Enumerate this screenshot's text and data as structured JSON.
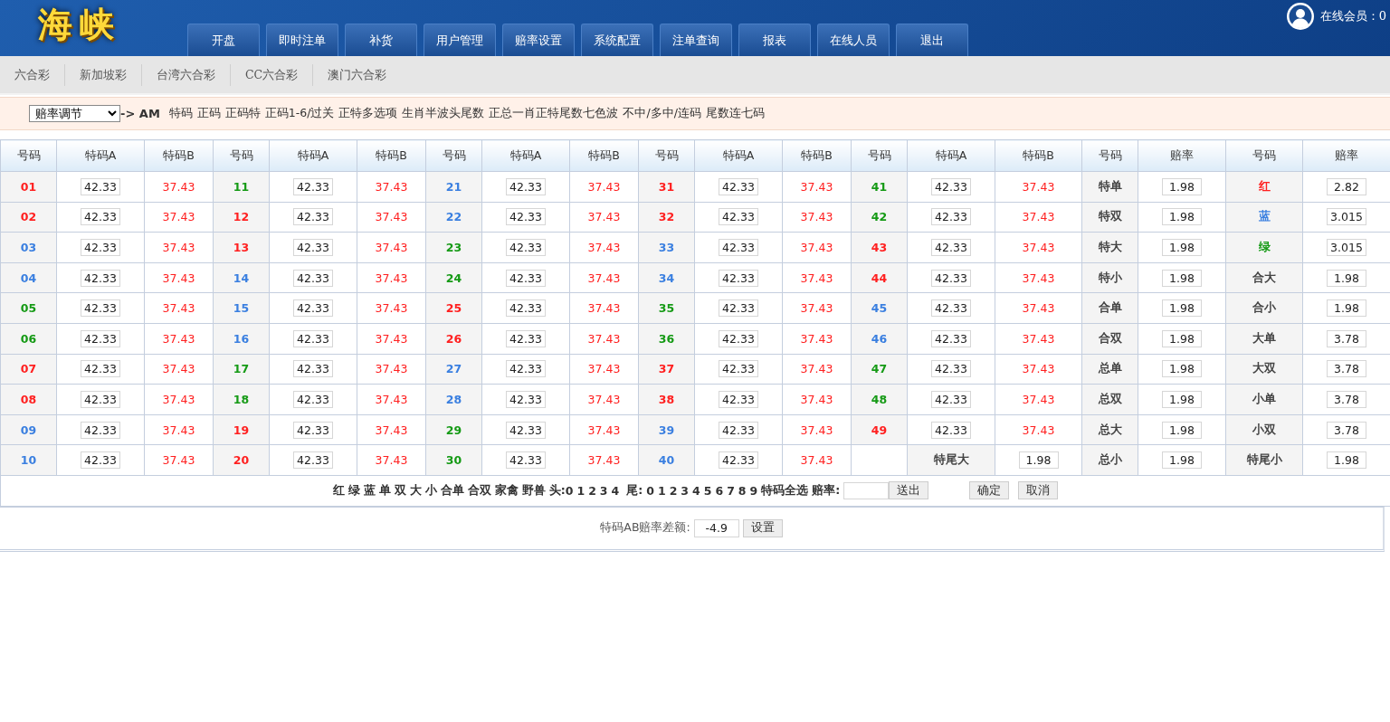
{
  "header": {
    "logo": "海峡",
    "nav": [
      "开盘",
      "即时注单",
      "补货",
      "用户管理",
      "赔率设置",
      "系统配置",
      "注单查询",
      "报表",
      "在线人员",
      "退出"
    ],
    "online": "在线会员：0"
  },
  "subnav": [
    "六合彩",
    "新加坡彩",
    "台湾六合彩",
    "CC六合彩",
    "澳门六合彩"
  ],
  "odds_bar": {
    "select": "赔率调节",
    "arrow": "-> AM",
    "links": [
      "特码",
      "正码",
      "正码特",
      "正码1-6/过关",
      "正特多选项",
      "生肖半波头尾数",
      "正总一肖正特尾数七色波",
      "不中/多中/连码",
      "尾数连七码"
    ]
  },
  "table": {
    "columns": [
      "号码",
      "特码A",
      "特码B",
      "号码",
      "特码A",
      "特码B",
      "号码",
      "特码A",
      "特码B",
      "号码",
      "特码A",
      "特码B",
      "号码",
      "特码A",
      "特码B",
      "号码",
      "赔率",
      "号码",
      "赔率"
    ],
    "rows": [
      {
        "cells": [
          {
            "kind": "num",
            "text": "01",
            "color": "#ff2020"
          },
          {
            "kind": "input",
            "value": "42.33"
          },
          {
            "kind": "odds",
            "text": "37.43"
          },
          {
            "kind": "num",
            "text": "11",
            "color": "#159a15"
          },
          {
            "kind": "input",
            "value": "42.33"
          },
          {
            "kind": "odds",
            "text": "37.43"
          },
          {
            "kind": "num",
            "text": "21",
            "color": "#3a7fe0"
          },
          {
            "kind": "input",
            "value": "42.33"
          },
          {
            "kind": "odds",
            "text": "37.43"
          },
          {
            "kind": "num",
            "text": "31",
            "color": "#ff2020"
          },
          {
            "kind": "input",
            "value": "42.33"
          },
          {
            "kind": "odds",
            "text": "37.43"
          },
          {
            "kind": "num",
            "text": "41",
            "color": "#159a15"
          },
          {
            "kind": "input",
            "value": "42.33"
          },
          {
            "kind": "odds",
            "text": "37.43"
          },
          {
            "kind": "label",
            "text": "特单"
          },
          {
            "kind": "input",
            "value": "1.98"
          },
          {
            "kind": "num",
            "text": "红",
            "color": "#ff2020"
          },
          {
            "kind": "input",
            "value": "2.82"
          }
        ]
      },
      {
        "cells": [
          {
            "kind": "num",
            "text": "02",
            "color": "#ff2020"
          },
          {
            "kind": "input",
            "value": "42.33"
          },
          {
            "kind": "odds",
            "text": "37.43"
          },
          {
            "kind": "num",
            "text": "12",
            "color": "#ff2020"
          },
          {
            "kind": "input",
            "value": "42.33"
          },
          {
            "kind": "odds",
            "text": "37.43"
          },
          {
            "kind": "num",
            "text": "22",
            "color": "#3a7fe0"
          },
          {
            "kind": "input",
            "value": "42.33"
          },
          {
            "kind": "odds",
            "text": "37.43"
          },
          {
            "kind": "num",
            "text": "32",
            "color": "#ff2020"
          },
          {
            "kind": "input",
            "value": "42.33"
          },
          {
            "kind": "odds",
            "text": "37.43"
          },
          {
            "kind": "num",
            "text": "42",
            "color": "#159a15"
          },
          {
            "kind": "input",
            "value": "42.33"
          },
          {
            "kind": "odds",
            "text": "37.43"
          },
          {
            "kind": "label",
            "text": "特双"
          },
          {
            "kind": "input",
            "value": "1.98"
          },
          {
            "kind": "num",
            "text": "蓝",
            "color": "#3a7fe0"
          },
          {
            "kind": "input",
            "value": "3.015"
          }
        ]
      },
      {
        "cells": [
          {
            "kind": "num",
            "text": "03",
            "color": "#3a7fe0"
          },
          {
            "kind": "input",
            "value": "42.33"
          },
          {
            "kind": "odds",
            "text": "37.43"
          },
          {
            "kind": "num",
            "text": "13",
            "color": "#ff2020"
          },
          {
            "kind": "input",
            "value": "42.33"
          },
          {
            "kind": "odds",
            "text": "37.43"
          },
          {
            "kind": "num",
            "text": "23",
            "color": "#159a15"
          },
          {
            "kind": "input",
            "value": "42.33"
          },
          {
            "kind": "odds",
            "text": "37.43"
          },
          {
            "kind": "num",
            "text": "33",
            "color": "#3a7fe0"
          },
          {
            "kind": "input",
            "value": "42.33"
          },
          {
            "kind": "odds",
            "text": "37.43"
          },
          {
            "kind": "num",
            "text": "43",
            "color": "#ff2020"
          },
          {
            "kind": "input",
            "value": "42.33"
          },
          {
            "kind": "odds",
            "text": "37.43"
          },
          {
            "kind": "label",
            "text": "特大"
          },
          {
            "kind": "input",
            "value": "1.98"
          },
          {
            "kind": "num",
            "text": "绿",
            "color": "#159a15"
          },
          {
            "kind": "input",
            "value": "3.015"
          }
        ]
      },
      {
        "cells": [
          {
            "kind": "num",
            "text": "04",
            "color": "#3a7fe0"
          },
          {
            "kind": "input",
            "value": "42.33"
          },
          {
            "kind": "odds",
            "text": "37.43"
          },
          {
            "kind": "num",
            "text": "14",
            "color": "#3a7fe0"
          },
          {
            "kind": "input",
            "value": "42.33"
          },
          {
            "kind": "odds",
            "text": "37.43"
          },
          {
            "kind": "num",
            "text": "24",
            "color": "#159a15"
          },
          {
            "kind": "input",
            "value": "42.33"
          },
          {
            "kind": "odds",
            "text": "37.43"
          },
          {
            "kind": "num",
            "text": "34",
            "color": "#3a7fe0"
          },
          {
            "kind": "input",
            "value": "42.33"
          },
          {
            "kind": "odds",
            "text": "37.43"
          },
          {
            "kind": "num",
            "text": "44",
            "color": "#ff2020"
          },
          {
            "kind": "input",
            "value": "42.33"
          },
          {
            "kind": "odds",
            "text": "37.43"
          },
          {
            "kind": "label",
            "text": "特小"
          },
          {
            "kind": "input",
            "value": "1.98"
          },
          {
            "kind": "label",
            "text": "合大"
          },
          {
            "kind": "input",
            "value": "1.98"
          }
        ]
      },
      {
        "cells": [
          {
            "kind": "num",
            "text": "05",
            "color": "#159a15"
          },
          {
            "kind": "input",
            "value": "42.33"
          },
          {
            "kind": "odds",
            "text": "37.43"
          },
          {
            "kind": "num",
            "text": "15",
            "color": "#3a7fe0"
          },
          {
            "kind": "input",
            "value": "42.33"
          },
          {
            "kind": "odds",
            "text": "37.43"
          },
          {
            "kind": "num",
            "text": "25",
            "color": "#ff2020"
          },
          {
            "kind": "input",
            "value": "42.33"
          },
          {
            "kind": "odds",
            "text": "37.43"
          },
          {
            "kind": "num",
            "text": "35",
            "color": "#159a15"
          },
          {
            "kind": "input",
            "value": "42.33"
          },
          {
            "kind": "odds",
            "text": "37.43"
          },
          {
            "kind": "num",
            "text": "45",
            "color": "#3a7fe0"
          },
          {
            "kind": "input",
            "value": "42.33"
          },
          {
            "kind": "odds",
            "text": "37.43"
          },
          {
            "kind": "label",
            "text": "合单"
          },
          {
            "kind": "input",
            "value": "1.98"
          },
          {
            "kind": "label",
            "text": "合小"
          },
          {
            "kind": "input",
            "value": "1.98"
          }
        ]
      },
      {
        "cells": [
          {
            "kind": "num",
            "text": "06",
            "color": "#159a15"
          },
          {
            "kind": "input",
            "value": "42.33"
          },
          {
            "kind": "odds",
            "text": "37.43"
          },
          {
            "kind": "num",
            "text": "16",
            "color": "#3a7fe0"
          },
          {
            "kind": "input",
            "value": "42.33"
          },
          {
            "kind": "odds",
            "text": "37.43"
          },
          {
            "kind": "num",
            "text": "26",
            "color": "#ff2020"
          },
          {
            "kind": "input",
            "value": "42.33"
          },
          {
            "kind": "odds",
            "text": "37.43"
          },
          {
            "kind": "num",
            "text": "36",
            "color": "#159a15"
          },
          {
            "kind": "input",
            "value": "42.33"
          },
          {
            "kind": "odds",
            "text": "37.43"
          },
          {
            "kind": "num",
            "text": "46",
            "color": "#3a7fe0"
          },
          {
            "kind": "input",
            "value": "42.33"
          },
          {
            "kind": "odds",
            "text": "37.43"
          },
          {
            "kind": "label",
            "text": "合双"
          },
          {
            "kind": "input",
            "value": "1.98"
          },
          {
            "kind": "label",
            "text": "大单"
          },
          {
            "kind": "input",
            "value": "3.78"
          }
        ]
      },
      {
        "cells": [
          {
            "kind": "num",
            "text": "07",
            "color": "#ff2020"
          },
          {
            "kind": "input",
            "value": "42.33"
          },
          {
            "kind": "odds",
            "text": "37.43"
          },
          {
            "kind": "num",
            "text": "17",
            "color": "#159a15"
          },
          {
            "kind": "input",
            "value": "42.33"
          },
          {
            "kind": "odds",
            "text": "37.43"
          },
          {
            "kind": "num",
            "text": "27",
            "color": "#3a7fe0"
          },
          {
            "kind": "input",
            "value": "42.33"
          },
          {
            "kind": "odds",
            "text": "37.43"
          },
          {
            "kind": "num",
            "text": "37",
            "color": "#ff2020"
          },
          {
            "kind": "input",
            "value": "42.33"
          },
          {
            "kind": "odds",
            "text": "37.43"
          },
          {
            "kind": "num",
            "text": "47",
            "color": "#159a15"
          },
          {
            "kind": "input",
            "value": "42.33"
          },
          {
            "kind": "odds",
            "text": "37.43"
          },
          {
            "kind": "label",
            "text": "总单"
          },
          {
            "kind": "input",
            "value": "1.98"
          },
          {
            "kind": "label",
            "text": "大双"
          },
          {
            "kind": "input",
            "value": "3.78"
          }
        ]
      },
      {
        "cells": [
          {
            "kind": "num",
            "text": "08",
            "color": "#ff2020"
          },
          {
            "kind": "input",
            "value": "42.33"
          },
          {
            "kind": "odds",
            "text": "37.43"
          },
          {
            "kind": "num",
            "text": "18",
            "color": "#159a15"
          },
          {
            "kind": "input",
            "value": "42.33"
          },
          {
            "kind": "odds",
            "text": "37.43"
          },
          {
            "kind": "num",
            "text": "28",
            "color": "#3a7fe0"
          },
          {
            "kind": "input",
            "value": "42.33"
          },
          {
            "kind": "odds",
            "text": "37.43"
          },
          {
            "kind": "num",
            "text": "38",
            "color": "#ff2020"
          },
          {
            "kind": "input",
            "value": "42.33"
          },
          {
            "kind": "odds",
            "text": "37.43"
          },
          {
            "kind": "num",
            "text": "48",
            "color": "#159a15"
          },
          {
            "kind": "input",
            "value": "42.33"
          },
          {
            "kind": "odds",
            "text": "37.43"
          },
          {
            "kind": "label",
            "text": "总双"
          },
          {
            "kind": "input",
            "value": "1.98"
          },
          {
            "kind": "label",
            "text": "小单"
          },
          {
            "kind": "input",
            "value": "3.78"
          }
        ]
      },
      {
        "cells": [
          {
            "kind": "num",
            "text": "09",
            "color": "#3a7fe0"
          },
          {
            "kind": "input",
            "value": "42.33"
          },
          {
            "kind": "odds",
            "text": "37.43"
          },
          {
            "kind": "num",
            "text": "19",
            "color": "#ff2020"
          },
          {
            "kind": "input",
            "value": "42.33"
          },
          {
            "kind": "odds",
            "text": "37.43"
          },
          {
            "kind": "num",
            "text": "29",
            "color": "#159a15"
          },
          {
            "kind": "input",
            "value": "42.33"
          },
          {
            "kind": "odds",
            "text": "37.43"
          },
          {
            "kind": "num",
            "text": "39",
            "color": "#3a7fe0"
          },
          {
            "kind": "input",
            "value": "42.33"
          },
          {
            "kind": "odds",
            "text": "37.43"
          },
          {
            "kind": "num",
            "text": "49",
            "color": "#ff2020"
          },
          {
            "kind": "input",
            "value": "42.33"
          },
          {
            "kind": "odds",
            "text": "37.43"
          },
          {
            "kind": "label",
            "text": "总大"
          },
          {
            "kind": "input",
            "value": "1.98"
          },
          {
            "kind": "label",
            "text": "小双"
          },
          {
            "kind": "input",
            "value": "3.78"
          }
        ]
      },
      {
        "cells": [
          {
            "kind": "num",
            "text": "10",
            "color": "#3a7fe0"
          },
          {
            "kind": "input",
            "value": "42.33"
          },
          {
            "kind": "odds",
            "text": "37.43"
          },
          {
            "kind": "num",
            "text": "20",
            "color": "#ff2020"
          },
          {
            "kind": "input",
            "value": "42.33"
          },
          {
            "kind": "odds",
            "text": "37.43"
          },
          {
            "kind": "num",
            "text": "30",
            "color": "#159a15"
          },
          {
            "kind": "input",
            "value": "42.33"
          },
          {
            "kind": "odds",
            "text": "37.43"
          },
          {
            "kind": "num",
            "text": "40",
            "color": "#3a7fe0"
          },
          {
            "kind": "input",
            "value": "42.33"
          },
          {
            "kind": "odds",
            "text": "37.43"
          },
          {
            "kind": "blank"
          },
          {
            "kind": "label",
            "text": "特尾大"
          },
          {
            "kind": "input",
            "value": "1.98"
          },
          {
            "kind": "label",
            "text": "总小"
          },
          {
            "kind": "input",
            "value": "1.98"
          },
          {
            "kind": "label",
            "text": "特尾小"
          },
          {
            "kind": "input",
            "value": "1.98"
          }
        ]
      }
    ]
  },
  "quick_select": {
    "items": [
      "红",
      "绿",
      "蓝",
      "单",
      "双",
      "大",
      "小",
      "合单",
      "合双",
      "家禽",
      "野兽"
    ],
    "head_label": "头:",
    "head_digits": [
      "0",
      "1",
      "2",
      "3",
      "4"
    ],
    "tail_label": "尾:",
    "tail_digits": [
      "0",
      "1",
      "2",
      "3",
      "4",
      "5",
      "6",
      "7",
      "8",
      "9"
    ],
    "all_label": "特码全选",
    "odds_label": "赔率:",
    "send": "送出",
    "confirm": "确定",
    "cancel": "取消"
  },
  "diff": {
    "label": "特码AB赔率差额:",
    "value": "-4.9",
    "button": "设置"
  }
}
